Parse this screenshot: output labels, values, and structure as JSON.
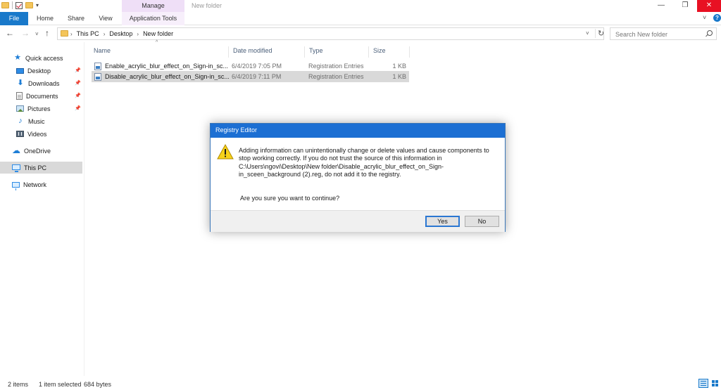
{
  "window": {
    "title": "New folder",
    "contextual_tab_group": "Manage",
    "controls": {
      "minimize": "—",
      "maximize": "❐",
      "close": "✕"
    }
  },
  "ribbon": {
    "tabs": [
      {
        "label": "File"
      },
      {
        "label": "Home"
      },
      {
        "label": "Share"
      },
      {
        "label": "View"
      },
      {
        "label": "Application Tools"
      }
    ],
    "help_label": "?"
  },
  "address_bar": {
    "breadcrumbs": [
      "This PC",
      "Desktop",
      "New folder"
    ]
  },
  "search": {
    "placeholder": "Search New folder"
  },
  "nav_pane": {
    "items": [
      {
        "label": "Quick access",
        "icon": "star-icon"
      },
      {
        "label": "Desktop",
        "icon": "desktop-folder-icon",
        "pinned": true
      },
      {
        "label": "Downloads",
        "icon": "download-arrow-icon",
        "pinned": true
      },
      {
        "label": "Documents",
        "icon": "documents-icon",
        "pinned": true
      },
      {
        "label": "Pictures",
        "icon": "pictures-icon",
        "pinned": true
      },
      {
        "label": "Music",
        "icon": "music-note-icon"
      },
      {
        "label": "Videos",
        "icon": "videos-icon"
      },
      {
        "label": "OneDrive",
        "icon": "cloud-icon"
      },
      {
        "label": "This PC",
        "icon": "computer-icon",
        "selected": true
      },
      {
        "label": "Network",
        "icon": "network-icon"
      }
    ]
  },
  "file_list": {
    "columns": [
      "Name",
      "Date modified",
      "Type",
      "Size"
    ],
    "rows": [
      {
        "name": "Enable_acrylic_blur_effect_on_Sign-in_sc...",
        "date": "6/4/2019 7:05 PM",
        "type": "Registration Entries",
        "size": "1 KB"
      },
      {
        "name": "Disable_acrylic_blur_effect_on_Sign-in_sc...",
        "date": "6/4/2019 7:11 PM",
        "type": "Registration Entries",
        "size": "1 KB",
        "selected": true
      }
    ]
  },
  "status_bar": {
    "item_count": "2 items",
    "selection": "1 item selected",
    "size": "684 bytes"
  },
  "dialog": {
    "title": "Registry Editor",
    "message": "Adding information can unintentionally change or delete values and cause components to stop working correctly. If you do not trust the source of this information in C:\\Users\\ngovi\\Desktop\\New folder\\Disable_acrylic_blur_effect_on_Sign-in_sceen_background (2).reg, do not add it to the registry.",
    "question": "Are you sure you want to continue?",
    "yes_label": "Yes",
    "no_label": "No",
    "icon": "warning-icon"
  },
  "colors": {
    "accent": "#1979ca",
    "dialog_title": "#1c6fd3",
    "close_button": "#e81123",
    "manage_tab": "#efdff7",
    "selection": "#d9d9d9"
  }
}
